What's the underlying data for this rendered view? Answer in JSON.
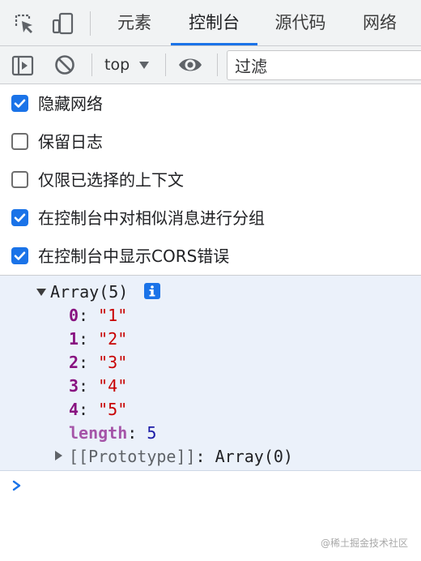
{
  "tabs": [
    {
      "label": "元素"
    },
    {
      "label": "控制台"
    },
    {
      "label": "源代码"
    },
    {
      "label": "网络"
    }
  ],
  "active_tab": "控制台",
  "toolbar": {
    "context": "top",
    "filter_value": "过滤"
  },
  "settings": [
    {
      "label": "隐藏网络",
      "checked": true
    },
    {
      "label": "保留日志",
      "checked": false
    },
    {
      "label": "仅限已选择的上下文",
      "checked": false
    },
    {
      "label": "在控制台中对相似消息进行分组",
      "checked": true
    },
    {
      "label": "在控制台中显示CORS错误",
      "checked": true
    }
  ],
  "console": {
    "array_summary": "Array(5)",
    "items": [
      {
        "key": "0",
        "value": "\"1\""
      },
      {
        "key": "1",
        "value": "\"2\""
      },
      {
        "key": "2",
        "value": "\"3\""
      },
      {
        "key": "3",
        "value": "\"4\""
      },
      {
        "key": "4",
        "value": "\"5\""
      }
    ],
    "length_key": "length",
    "length_value": "5",
    "prototype_key": "[[Prototype]]",
    "prototype_value": "Array(0)"
  },
  "watermark": "@稀土掘金技术社区",
  "colors": {
    "accent": "#1a73e8",
    "log_background": "#ebf1fa",
    "key_purple": "#881280",
    "string_red": "#c80000",
    "number_blue": "#1a1aa6"
  },
  "icons": [
    "inspect-element-icon",
    "device-toolbar-icon",
    "sidebar-toggle-icon",
    "clear-console-icon",
    "dropdown-arrow-icon",
    "eye-icon",
    "checkbox-check-icon",
    "expand-triangle-icon",
    "info-icon",
    "collapse-triangle-icon",
    "prompt-chevron-icon"
  ]
}
